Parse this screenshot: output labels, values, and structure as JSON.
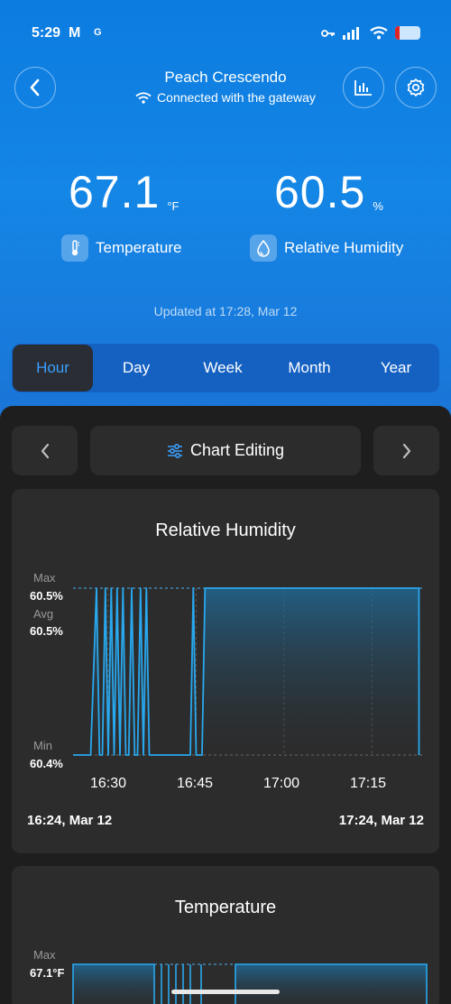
{
  "status_bar": {
    "time": "5:29",
    "mail_icon": "M",
    "g_icon": "G"
  },
  "header": {
    "device_name": "Peach Crescendo",
    "connection_status": "Connected with the gateway"
  },
  "readings": {
    "temperature": {
      "value": "67.1",
      "unit": "°F",
      "label": "Temperature"
    },
    "humidity": {
      "value": "60.5",
      "unit": "%",
      "label": "Relative Humidity"
    }
  },
  "updated_text": "Updated at 17:28, Mar 12",
  "tabs": [
    {
      "label": "Hour",
      "active": true
    },
    {
      "label": "Day"
    },
    {
      "label": "Week"
    },
    {
      "label": "Month"
    },
    {
      "label": "Year"
    }
  ],
  "chart_controls": {
    "edit_label": "Chart Editing"
  },
  "colors": {
    "accent": "#3aa0ff",
    "line": "#29a8ee",
    "background": "#1e1e1e",
    "card": "#2c2c2c"
  },
  "chart_data": [
    {
      "type": "line",
      "title": "Relative Humidity",
      "y_labels": {
        "max_label": "Max",
        "max_value": "60.5%",
        "avg_label": "Avg",
        "avg_value": "60.5%",
        "min_label": "Min",
        "min_value": "60.4%"
      },
      "ylim": [
        60.4,
        60.5
      ],
      "x_ticks": [
        "16:30",
        "16:45",
        "17:00",
        "17:15"
      ],
      "range_start": "16:24, Mar 12",
      "range_end": "17:24, Mar 12",
      "series": [
        {
          "x_minutes_from_start": [
            0,
            3,
            4,
            4.5,
            5,
            5.5,
            6,
            6.5,
            7,
            7.5,
            8,
            8.5,
            9,
            9.5,
            10,
            10.5,
            11,
            11.5,
            12,
            12.5,
            13,
            13.5,
            14,
            20,
            20.5,
            21,
            21.5,
            22,
            22.5,
            23,
            59
          ],
          "values": [
            60.4,
            60.4,
            60.5,
            60.4,
            60.4,
            60.5,
            60.4,
            60.5,
            60.4,
            60.5,
            60.4,
            60.5,
            60.4,
            60.4,
            60.5,
            60.4,
            60.4,
            60.5,
            60.4,
            60.5,
            60.4,
            60.4,
            60.4,
            60.4,
            60.5,
            60.4,
            60.4,
            60.4,
            60.5,
            60.5,
            60.5
          ]
        }
      ]
    },
    {
      "type": "line",
      "title": "Temperature",
      "y_labels": {
        "max_label": "Max",
        "max_value": "67.1°F"
      }
    }
  ]
}
